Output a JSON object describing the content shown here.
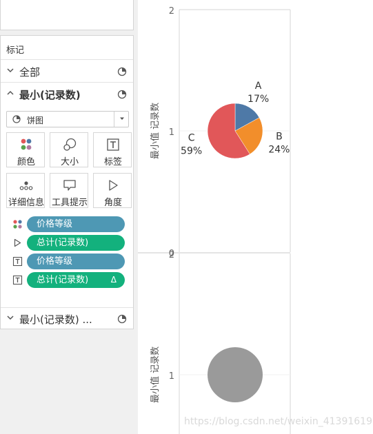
{
  "marks_panel": {
    "title": "标记",
    "all_row_label": "全部",
    "active_row_label": "最小(记录数)",
    "mark_type": "饼图",
    "buttons": {
      "color": "颜色",
      "size": "大小",
      "label": "标签",
      "detail": "详细信息",
      "tooltip": "工具提示",
      "angle": "角度"
    },
    "pills": [
      {
        "icon": "color-dots-icon",
        "label": "价格等级"
      },
      {
        "icon": "angle-icon",
        "label": "总计(记录数)"
      },
      {
        "icon": "text-label-icon",
        "label": "价格等级"
      },
      {
        "icon": "text-label-icon",
        "label": "总计(记录数)",
        "suffix": "Δ"
      }
    ],
    "collapsed_row_label": "最小(记录数) ..."
  },
  "colors": {
    "pill_blue": "#4e98b4",
    "pill_green": "#13b17d",
    "slice_a": "#4e79a7",
    "slice_b": "#f28e2b",
    "slice_c": "#e15759",
    "circle_gray": "#9a9a9a"
  },
  "chart_data": [
    {
      "type": "pie",
      "ylabel": "最小值 记录数",
      "ylim": [
        0,
        2
      ],
      "yticks": [
        "2",
        "1",
        "0"
      ],
      "center_y": 1,
      "slices": [
        {
          "name": "A",
          "percent": 17,
          "label": "17%"
        },
        {
          "name": "B",
          "percent": 24,
          "label": "24%"
        },
        {
          "name": "C",
          "percent": 59,
          "label": "59%"
        }
      ]
    },
    {
      "type": "pie",
      "ylabel": "最小值 记录数",
      "ylim": [
        0,
        2
      ],
      "yticks": [
        "2",
        "1"
      ],
      "center_y": 1,
      "slices": [
        {
          "name": "",
          "percent": 100,
          "label": ""
        }
      ]
    }
  ],
  "watermark": "https://blog.csdn.net/weixin_41391619"
}
